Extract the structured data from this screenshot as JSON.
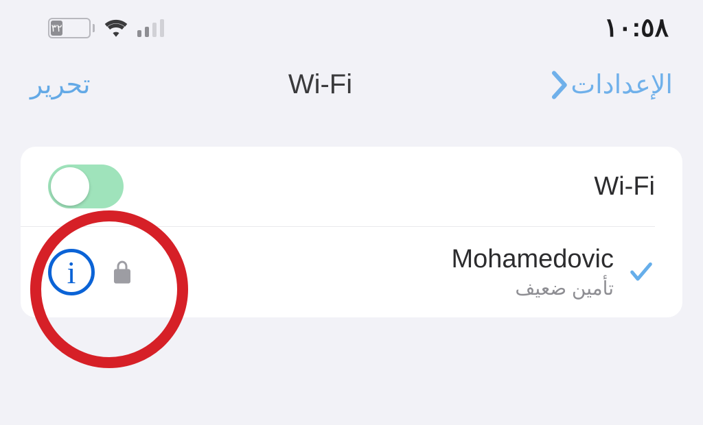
{
  "status": {
    "battery_text": "٣٢",
    "time": "١٠:٥٨"
  },
  "nav": {
    "back_label": "الإعدادات",
    "title": "Wi-Fi",
    "edit_label": "تحرير"
  },
  "wifi": {
    "label": "Wi-Fi",
    "enabled": true
  },
  "connected": {
    "ssid": "Mohamedovic",
    "security_note": "تأمين ضعيف",
    "info_glyph": "i"
  },
  "colors": {
    "tint": "#63a9e6",
    "highlight_circle": "#d62027",
    "info_blue": "#0b63d6",
    "toggle_on": "#9fe3bb"
  }
}
